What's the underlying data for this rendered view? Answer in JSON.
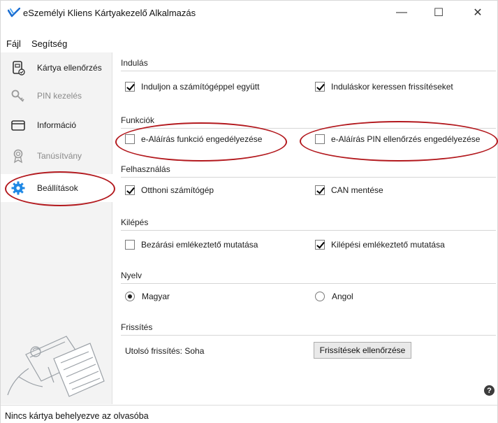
{
  "window": {
    "title": "eSzemélyi Kliens Kártyakezelő Alkalmazás",
    "controls": {
      "minimize": "—",
      "maximize": "☐",
      "close": "✕"
    }
  },
  "menu": {
    "file": "Fájl",
    "help": "Segítség"
  },
  "sidebar": {
    "items": [
      {
        "label": "Kártya ellenőrzés",
        "icon": "card-check-icon",
        "state": "normal"
      },
      {
        "label": "PIN kezelés",
        "icon": "key-icon",
        "state": "disabled"
      },
      {
        "label": "Információ",
        "icon": "card-info-icon",
        "state": "normal"
      },
      {
        "label": "Tanúsítvány",
        "icon": "certificate-icon",
        "state": "disabled"
      },
      {
        "label": "Beállítások",
        "icon": "gear-icon",
        "state": "active"
      }
    ]
  },
  "sections": {
    "startup": {
      "title": "Indulás",
      "options": [
        {
          "label": "Induljon a számítógéppel együtt",
          "checked": true
        },
        {
          "label": "Induláskor keressen frissítéseket",
          "checked": true
        }
      ]
    },
    "functions": {
      "title": "Funkciók",
      "options": [
        {
          "label": "e-Aláírás funkció engedélyezése",
          "checked": false
        },
        {
          "label": "e-Aláírás PIN ellenőrzés engedélyezése",
          "checked": false
        }
      ]
    },
    "usage": {
      "title": "Felhasználás",
      "options": [
        {
          "label": "Otthoni számítógép",
          "checked": true
        },
        {
          "label": "CAN mentése",
          "checked": true
        }
      ]
    },
    "exit": {
      "title": "Kilépés",
      "options": [
        {
          "label": "Bezárási emlékeztető mutatása",
          "checked": false
        },
        {
          "label": "Kilépési emlékeztető mutatása",
          "checked": true
        }
      ]
    },
    "language": {
      "title": "Nyelv",
      "options": [
        {
          "label": "Magyar",
          "selected": true
        },
        {
          "label": "Angol",
          "selected": false
        }
      ]
    },
    "update": {
      "title": "Frissítés",
      "last_update": "Utolsó frissítés: Soha",
      "check_button": "Frissítések ellenőrzése"
    }
  },
  "help_icon_glyph": "?",
  "status": {
    "text": "Nincs kártya behelyezve az olvasóba"
  },
  "colors": {
    "accent": "#1e88e5",
    "annotation": "#b3191e",
    "sidebar_bg": "#f3f3f3"
  }
}
